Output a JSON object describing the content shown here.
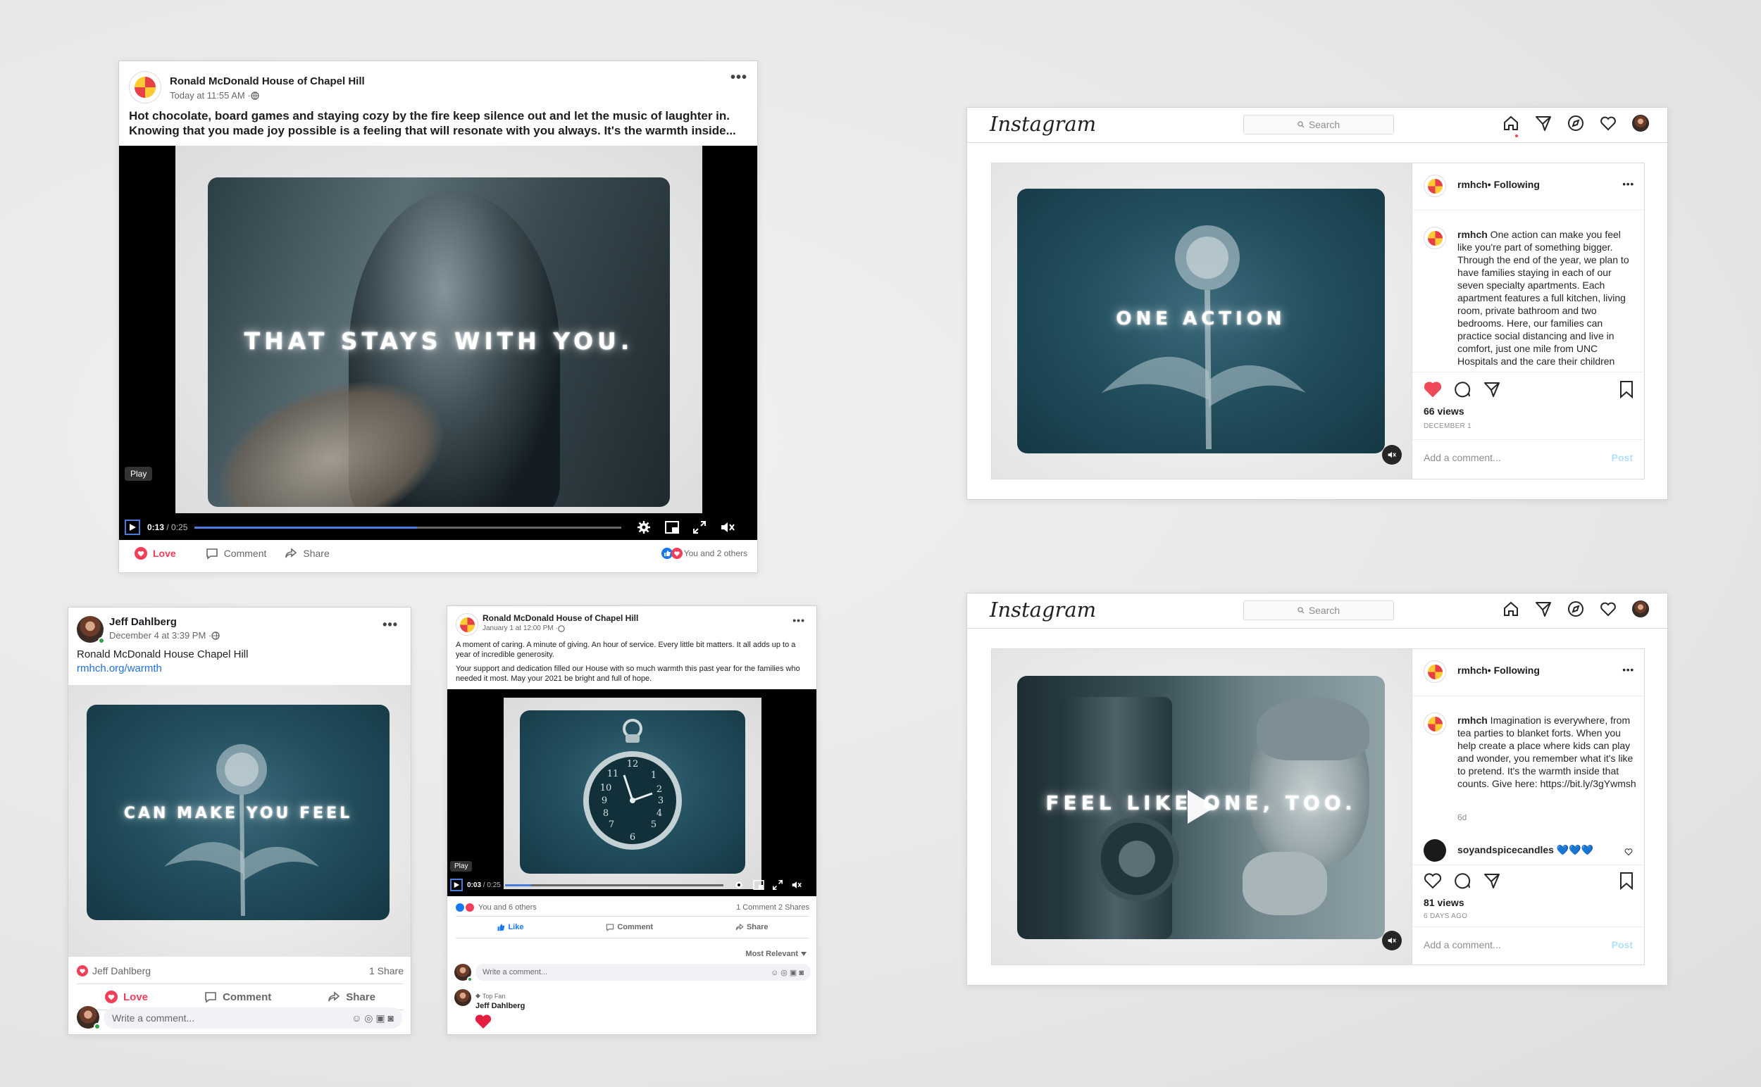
{
  "fb_main": {
    "page_name": "Ronald McDonald House of Chapel Hill",
    "timestamp": "Today at 11:55 AM · ",
    "text": "Hot chocolate, board games and staying cozy by the fire keep silence out and let the music of laughter in. Knowing that you made joy possible is a feeling that will resonate with you always. It's the warmth inside...",
    "overlay": "THAT STAYS WITH YOU.",
    "play_tooltip": "Play",
    "time_current": "0:13",
    "time_total": " / 0:25",
    "progress": 0.52,
    "love_label": "Love",
    "comment_label": "Comment",
    "share_label": "Share",
    "reactions_text": "You and 2 others"
  },
  "fb_jeff": {
    "name": "Jeff Dahlberg",
    "timestamp": "December 4 at 3:39 PM · ",
    "text": "Ronald McDonald House Chapel Hill",
    "link": "rmhch.org/warmth",
    "overlay": "CAN MAKE YOU FEEL",
    "reactor": "Jeff Dahlberg",
    "shares": "1 Share",
    "love_label": "Love",
    "comment_label": "Comment",
    "share_label": "Share",
    "comment_placeholder": "Write a comment..."
  },
  "fb_clock": {
    "page_name": "Ronald McDonald House of Chapel Hill",
    "timestamp": "January 1 at 12:00 PM · ",
    "text1": "A moment of caring.  A minute of giving.  An hour of service.  Every little bit matters.  It all adds up to a year of incredible generosity.",
    "text2": "Your support and dedication filled our House with so much warmth this past year for the families who needed it most.  May your 2021 be bright and full of hope.",
    "play_tooltip": "Play",
    "time_current": "0:03",
    "time_total": " / 0:25",
    "progress": 0.12,
    "reactions_text": "You and 6 others",
    "counts": "1 Comment  2 Shares",
    "like_label": "Like",
    "comment_label": "Comment",
    "share_label": "Share",
    "sort_label": "Most Relevant",
    "comment_placeholder": "Write a comment...",
    "top_fan_label": "Top Fan",
    "commenter": "Jeff Dahlberg"
  },
  "ig_top": {
    "logo": "Instagram",
    "search_placeholder": "Search",
    "user": "rmhch",
    "following": " • Following",
    "caption_user": "rmhch",
    "caption": " One action can make you feel like you're part of something bigger. Through the end of the year, we plan to have families staying in each of our seven specialty apartments. Each apartment features a full kitchen, living room, private bathroom and two bedrooms. Here, our families can practice social distancing and live in comfort, just one mile from UNC Hospitals and the care their children",
    "overlay": "ONE ACTION",
    "views": "66 views",
    "date": "DECEMBER 1",
    "comment_placeholder": "Add a comment...",
    "post_label": "Post",
    "liked": true
  },
  "ig_bottom": {
    "logo": "Instagram",
    "search_placeholder": "Search",
    "user": "rmhch",
    "following": " • Following",
    "caption_user": "rmhch",
    "caption": " Imagination is everywhere, from tea parties to blanket forts. When you help create a place where kids can play and wonder, you remember what it's like to pretend. It's the warmth inside that counts. Give here: https://bit.ly/3gYwmsh",
    "age": "6d",
    "commenter": "soyandspicecandles",
    "comment_text": " 💙💙💙",
    "overlay": "FEEL LIKE ONE, TOO.",
    "views": "81 views",
    "date": "6 DAYS AGO",
    "comment_placeholder": "Add a comment...",
    "post_label": "Post",
    "liked": false
  },
  "colors": {
    "fb_blue": "#1877f2",
    "fb_link": "#216fdb",
    "love_red": "#f33e58",
    "ig_heart": "#ed4956",
    "ig_post_blue": "#b2dffc",
    "teal_poster": "#23505f"
  },
  "icons": [
    "ellipsis-icon",
    "globe-icon",
    "play-icon",
    "gear-icon",
    "pip-icon",
    "fullscreen-icon",
    "mute-icon",
    "love-icon",
    "comment-icon",
    "share-icon",
    "like-icon",
    "home-icon",
    "direct-icon",
    "explore-icon",
    "heart-icon",
    "bookmark-icon",
    "search-icon",
    "dandelion-illustration",
    "pocket-watch-illustration"
  ]
}
